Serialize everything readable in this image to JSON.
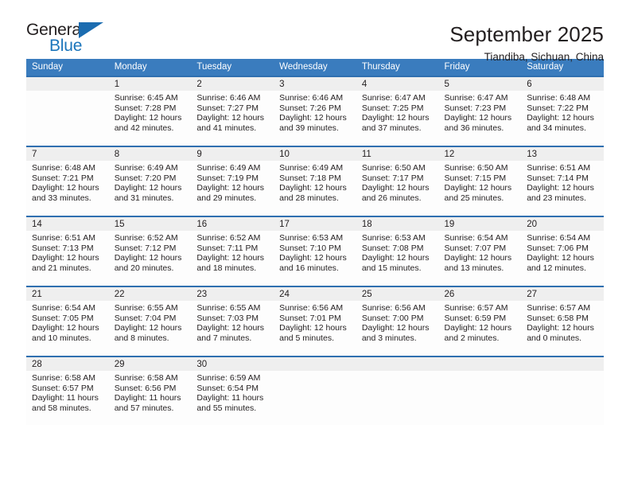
{
  "brand": {
    "name_part1": "General",
    "name_part2": "Blue",
    "logo_icon": "triangle-logo-icon"
  },
  "header": {
    "title": "September 2025",
    "location": "Tiandiba, Sichuan, China"
  },
  "calendar": {
    "weekday_headers": [
      "Sunday",
      "Monday",
      "Tuesday",
      "Wednesday",
      "Thursday",
      "Friday",
      "Saturday"
    ],
    "accent_color": "#3a7cbe",
    "border_color": "#2f6fb0",
    "daynum_band_color": "#efefef",
    "weeks": [
      [
        {
          "day": "",
          "sunrise": "",
          "sunset": "",
          "daylight1": "",
          "daylight2": ""
        },
        {
          "day": "1",
          "sunrise": "Sunrise: 6:45 AM",
          "sunset": "Sunset: 7:28 PM",
          "daylight1": "Daylight: 12 hours",
          "daylight2": "and 42 minutes."
        },
        {
          "day": "2",
          "sunrise": "Sunrise: 6:46 AM",
          "sunset": "Sunset: 7:27 PM",
          "daylight1": "Daylight: 12 hours",
          "daylight2": "and 41 minutes."
        },
        {
          "day": "3",
          "sunrise": "Sunrise: 6:46 AM",
          "sunset": "Sunset: 7:26 PM",
          "daylight1": "Daylight: 12 hours",
          "daylight2": "and 39 minutes."
        },
        {
          "day": "4",
          "sunrise": "Sunrise: 6:47 AM",
          "sunset": "Sunset: 7:25 PM",
          "daylight1": "Daylight: 12 hours",
          "daylight2": "and 37 minutes."
        },
        {
          "day": "5",
          "sunrise": "Sunrise: 6:47 AM",
          "sunset": "Sunset: 7:23 PM",
          "daylight1": "Daylight: 12 hours",
          "daylight2": "and 36 minutes."
        },
        {
          "day": "6",
          "sunrise": "Sunrise: 6:48 AM",
          "sunset": "Sunset: 7:22 PM",
          "daylight1": "Daylight: 12 hours",
          "daylight2": "and 34 minutes."
        }
      ],
      [
        {
          "day": "7",
          "sunrise": "Sunrise: 6:48 AM",
          "sunset": "Sunset: 7:21 PM",
          "daylight1": "Daylight: 12 hours",
          "daylight2": "and 33 minutes."
        },
        {
          "day": "8",
          "sunrise": "Sunrise: 6:49 AM",
          "sunset": "Sunset: 7:20 PM",
          "daylight1": "Daylight: 12 hours",
          "daylight2": "and 31 minutes."
        },
        {
          "day": "9",
          "sunrise": "Sunrise: 6:49 AM",
          "sunset": "Sunset: 7:19 PM",
          "daylight1": "Daylight: 12 hours",
          "daylight2": "and 29 minutes."
        },
        {
          "day": "10",
          "sunrise": "Sunrise: 6:49 AM",
          "sunset": "Sunset: 7:18 PM",
          "daylight1": "Daylight: 12 hours",
          "daylight2": "and 28 minutes."
        },
        {
          "day": "11",
          "sunrise": "Sunrise: 6:50 AM",
          "sunset": "Sunset: 7:17 PM",
          "daylight1": "Daylight: 12 hours",
          "daylight2": "and 26 minutes."
        },
        {
          "day": "12",
          "sunrise": "Sunrise: 6:50 AM",
          "sunset": "Sunset: 7:15 PM",
          "daylight1": "Daylight: 12 hours",
          "daylight2": "and 25 minutes."
        },
        {
          "day": "13",
          "sunrise": "Sunrise: 6:51 AM",
          "sunset": "Sunset: 7:14 PM",
          "daylight1": "Daylight: 12 hours",
          "daylight2": "and 23 minutes."
        }
      ],
      [
        {
          "day": "14",
          "sunrise": "Sunrise: 6:51 AM",
          "sunset": "Sunset: 7:13 PM",
          "daylight1": "Daylight: 12 hours",
          "daylight2": "and 21 minutes."
        },
        {
          "day": "15",
          "sunrise": "Sunrise: 6:52 AM",
          "sunset": "Sunset: 7:12 PM",
          "daylight1": "Daylight: 12 hours",
          "daylight2": "and 20 minutes."
        },
        {
          "day": "16",
          "sunrise": "Sunrise: 6:52 AM",
          "sunset": "Sunset: 7:11 PM",
          "daylight1": "Daylight: 12 hours",
          "daylight2": "and 18 minutes."
        },
        {
          "day": "17",
          "sunrise": "Sunrise: 6:53 AM",
          "sunset": "Sunset: 7:10 PM",
          "daylight1": "Daylight: 12 hours",
          "daylight2": "and 16 minutes."
        },
        {
          "day": "18",
          "sunrise": "Sunrise: 6:53 AM",
          "sunset": "Sunset: 7:08 PM",
          "daylight1": "Daylight: 12 hours",
          "daylight2": "and 15 minutes."
        },
        {
          "day": "19",
          "sunrise": "Sunrise: 6:54 AM",
          "sunset": "Sunset: 7:07 PM",
          "daylight1": "Daylight: 12 hours",
          "daylight2": "and 13 minutes."
        },
        {
          "day": "20",
          "sunrise": "Sunrise: 6:54 AM",
          "sunset": "Sunset: 7:06 PM",
          "daylight1": "Daylight: 12 hours",
          "daylight2": "and 12 minutes."
        }
      ],
      [
        {
          "day": "21",
          "sunrise": "Sunrise: 6:54 AM",
          "sunset": "Sunset: 7:05 PM",
          "daylight1": "Daylight: 12 hours",
          "daylight2": "and 10 minutes."
        },
        {
          "day": "22",
          "sunrise": "Sunrise: 6:55 AM",
          "sunset": "Sunset: 7:04 PM",
          "daylight1": "Daylight: 12 hours",
          "daylight2": "and 8 minutes."
        },
        {
          "day": "23",
          "sunrise": "Sunrise: 6:55 AM",
          "sunset": "Sunset: 7:03 PM",
          "daylight1": "Daylight: 12 hours",
          "daylight2": "and 7 minutes."
        },
        {
          "day": "24",
          "sunrise": "Sunrise: 6:56 AM",
          "sunset": "Sunset: 7:01 PM",
          "daylight1": "Daylight: 12 hours",
          "daylight2": "and 5 minutes."
        },
        {
          "day": "25",
          "sunrise": "Sunrise: 6:56 AM",
          "sunset": "Sunset: 7:00 PM",
          "daylight1": "Daylight: 12 hours",
          "daylight2": "and 3 minutes."
        },
        {
          "day": "26",
          "sunrise": "Sunrise: 6:57 AM",
          "sunset": "Sunset: 6:59 PM",
          "daylight1": "Daylight: 12 hours",
          "daylight2": "and 2 minutes."
        },
        {
          "day": "27",
          "sunrise": "Sunrise: 6:57 AM",
          "sunset": "Sunset: 6:58 PM",
          "daylight1": "Daylight: 12 hours",
          "daylight2": "and 0 minutes."
        }
      ],
      [
        {
          "day": "28",
          "sunrise": "Sunrise: 6:58 AM",
          "sunset": "Sunset: 6:57 PM",
          "daylight1": "Daylight: 11 hours",
          "daylight2": "and 58 minutes."
        },
        {
          "day": "29",
          "sunrise": "Sunrise: 6:58 AM",
          "sunset": "Sunset: 6:56 PM",
          "daylight1": "Daylight: 11 hours",
          "daylight2": "and 57 minutes."
        },
        {
          "day": "30",
          "sunrise": "Sunrise: 6:59 AM",
          "sunset": "Sunset: 6:54 PM",
          "daylight1": "Daylight: 11 hours",
          "daylight2": "and 55 minutes."
        },
        {
          "day": "",
          "sunrise": "",
          "sunset": "",
          "daylight1": "",
          "daylight2": ""
        },
        {
          "day": "",
          "sunrise": "",
          "sunset": "",
          "daylight1": "",
          "daylight2": ""
        },
        {
          "day": "",
          "sunrise": "",
          "sunset": "",
          "daylight1": "",
          "daylight2": ""
        },
        {
          "day": "",
          "sunrise": "",
          "sunset": "",
          "daylight1": "",
          "daylight2": ""
        }
      ]
    ]
  }
}
